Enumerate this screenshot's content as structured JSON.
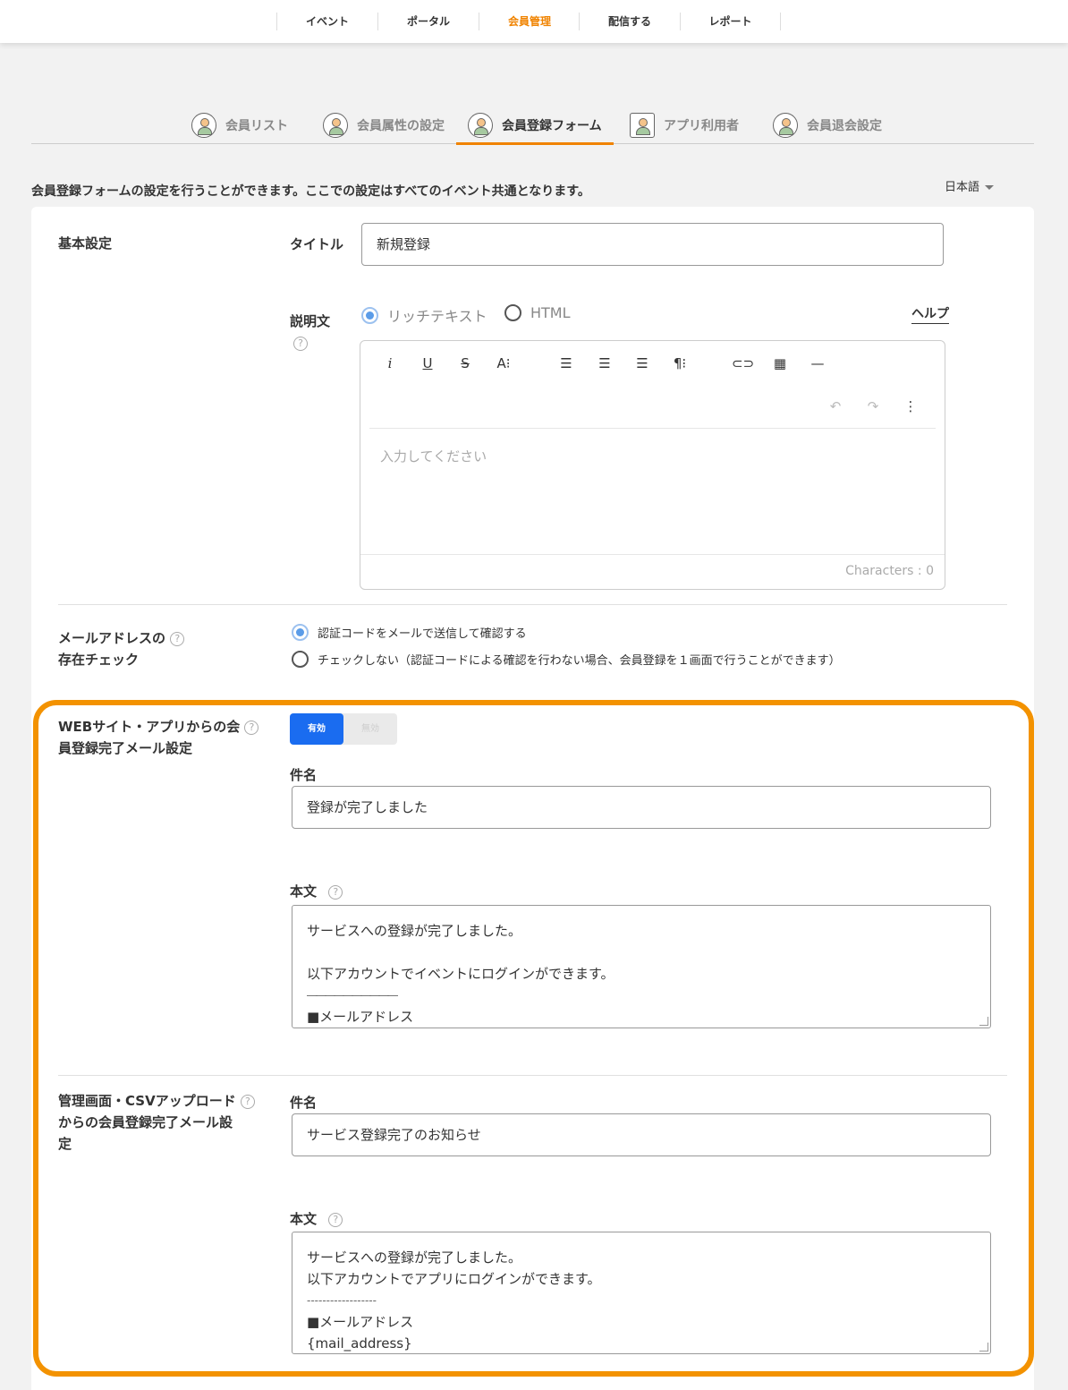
{
  "nav": {
    "items": [
      "イベント",
      "ポータル",
      "会員管理",
      "配信する",
      "レポート"
    ],
    "active_color": "#f08300"
  },
  "subtabs": [
    "会員リスト",
    "会員属性の設定",
    "会員登録フォーム",
    "アプリ利用者",
    "会員退会設定"
  ],
  "page": {
    "description": "会員登録フォームの設定を行うことができます。ここでの設定はすべてのイベント共通となります。",
    "language": "日本語"
  },
  "basic": {
    "section_label": "基本設定",
    "title_label": "タイトル",
    "title_value": "新規登録",
    "desc_label": "説明文",
    "radio_rich": "リッチテキスト",
    "radio_html": "HTML",
    "help_link": "ヘルプ",
    "editor_placeholder": "入力してください",
    "char_count": "Characters : 0"
  },
  "email_check": {
    "label_line1": "メールアドレスの",
    "label_line2": "存在チェック",
    "option1": "認証コードをメールで送信して確認する",
    "option2": "チェックしない（認証コードによる確認を行わない場合、会員登録を１画面で行うことができます）"
  },
  "web_mail": {
    "label_line1": "WEBサイト・アプリからの会",
    "label_line2": "員登録完了メール設定",
    "toggle_on": "有効",
    "toggle_off": "無効",
    "subject_label": "件名",
    "subject_value": "登録が完了しました",
    "body_label": "本文",
    "body_lines": [
      "サービスへの登録が完了しました。",
      "",
      "以下アカウントでイベントにログインができます。",
      "――――――――――",
      "■メールアドレス"
    ]
  },
  "admin_mail": {
    "label_line1": "管理画面・CSVアップロード",
    "label_line2": "からの会員登録完了メール設",
    "label_line3": "定",
    "subject_label": "件名",
    "subject_value": "サービス登録完了のお知らせ",
    "body_label": "本文",
    "body_lines": [
      "サービスへの登録が完了しました。",
      "以下アカウントでアプリにログインができます。",
      "------------------",
      "■メールアドレス",
      "{mail_address}"
    ]
  },
  "colors": {
    "accent_orange": "#f39200",
    "toggle_blue": "#1a6cf0",
    "radio_blue": "#5b9ce8"
  }
}
